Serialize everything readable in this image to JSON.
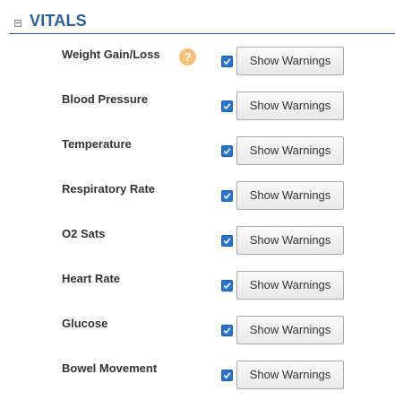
{
  "section": {
    "title": "VITALS",
    "toggle_icon": "collapse-minus-icon"
  },
  "help": {
    "glyph": "?",
    "icon": "help-question-icon",
    "color": "#f2c27a"
  },
  "accent_color": "#2f5f8f",
  "checkbox_color": "#2a74c7",
  "vitals": [
    {
      "label": "Weight Gain/Loss",
      "checked": true,
      "button_label": "Show Warnings",
      "has_help": true
    },
    {
      "label": "Blood Pressure",
      "checked": true,
      "button_label": "Show Warnings",
      "has_help": false
    },
    {
      "label": "Temperature",
      "checked": true,
      "button_label": "Show Warnings",
      "has_help": false
    },
    {
      "label": "Respiratory Rate",
      "checked": true,
      "button_label": "Show Warnings",
      "has_help": false
    },
    {
      "label": "O2 Sats",
      "checked": true,
      "button_label": "Show Warnings",
      "has_help": false
    },
    {
      "label": "Heart Rate",
      "checked": true,
      "button_label": "Show Warnings",
      "has_help": false
    },
    {
      "label": "Glucose",
      "checked": true,
      "button_label": "Show Warnings",
      "has_help": false
    },
    {
      "label": "Bowel Movement",
      "checked": true,
      "button_label": "Show Warnings",
      "has_help": false
    }
  ]
}
